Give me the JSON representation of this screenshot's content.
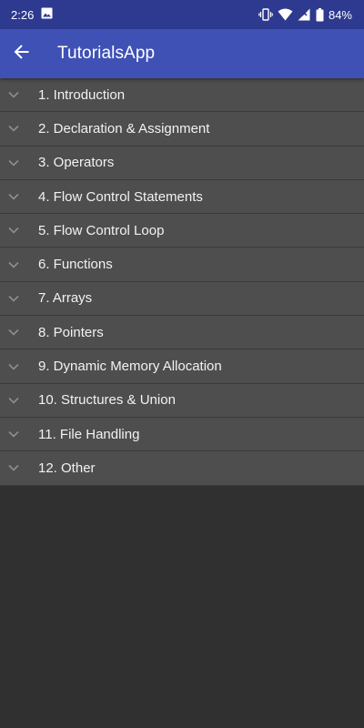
{
  "status_bar": {
    "time": "2:26",
    "battery": "84%",
    "icons": [
      "image-icon",
      "vibrate-icon",
      "wifi-icon",
      "cell-signal-icon",
      "battery-icon"
    ]
  },
  "app_bar": {
    "title": "TutorialsApp",
    "back_icon": "arrow-back-icon",
    "background": "#3f51b5"
  },
  "list": {
    "items": [
      {
        "label": "1. Introduction"
      },
      {
        "label": "2. Declaration & Assignment"
      },
      {
        "label": "3. Operators"
      },
      {
        "label": "4. Flow Control Statements"
      },
      {
        "label": "5. Flow Control Loop"
      },
      {
        "label": "6. Functions"
      },
      {
        "label": "7. Arrays"
      },
      {
        "label": "8. Pointers"
      },
      {
        "label": "9. Dynamic Memory Allocation"
      },
      {
        "label": "10. Structures & Union"
      },
      {
        "label": "11. File Handling"
      },
      {
        "label": "12. Other"
      }
    ]
  }
}
